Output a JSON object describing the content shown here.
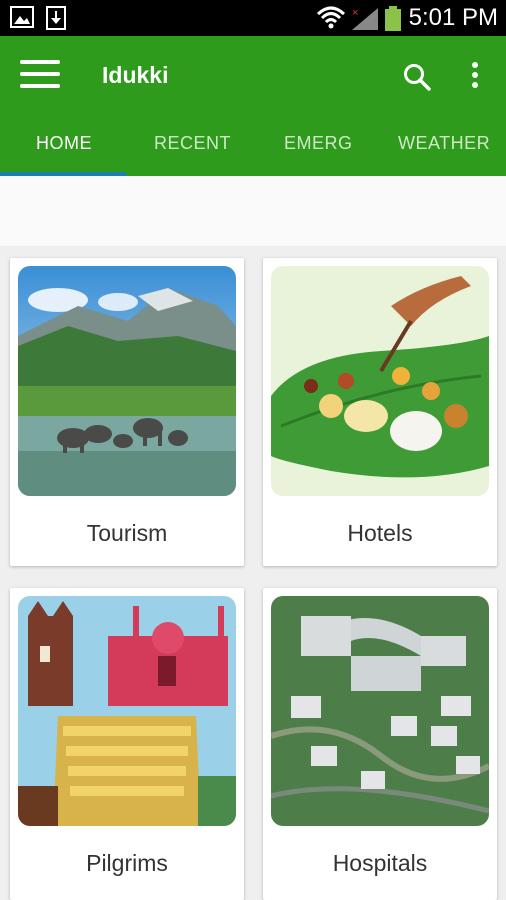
{
  "status_bar": {
    "time": "5:01 PM"
  },
  "app_bar": {
    "title": "Idukki"
  },
  "tabs": [
    {
      "label": "HOME",
      "active": true
    },
    {
      "label": "RECENT",
      "active": false
    },
    {
      "label": "EMERG",
      "active": false
    },
    {
      "label": "WEATHER",
      "active": false
    }
  ],
  "cards": [
    {
      "label": "Tourism"
    },
    {
      "label": "Hotels"
    },
    {
      "label": "Pilgrims"
    },
    {
      "label": "Hospitals"
    }
  ],
  "colors": {
    "primary": "#2e9b1c",
    "tab_indicator": "#1b7fb0"
  }
}
